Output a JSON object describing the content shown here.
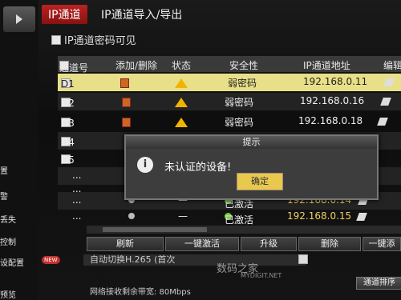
{
  "sidebar": {
    "items": [
      "置",
      "警",
      "丢失",
      "控制",
      "设配置"
    ],
    "preview_label": "预览",
    "new_badge": "NEW"
  },
  "tabs": [
    "IP通道",
    "IP通道导入/导出"
  ],
  "password_visible_label": "IP通道密码可见",
  "table": {
    "headers": [
      "通道号",
      "添加/删除",
      "状态",
      "安全性",
      "IP通道地址",
      "编辑"
    ],
    "rows": [
      {
        "channel": "D1",
        "security": "弱密码",
        "ip": "192.168.0.11"
      },
      {
        "channel": "D2",
        "security": "弱密码",
        "ip": "192.168.0.16"
      },
      {
        "channel": "D3",
        "security": "弱密码",
        "ip": "192.168.0.18"
      },
      {
        "channel": "D4",
        "security": "",
        "ip": ""
      },
      {
        "channel": "D5",
        "security": "",
        "ip": ""
      },
      {
        "channel": "...",
        "security": "",
        "ip": ""
      },
      {
        "channel": "...",
        "security": "",
        "ip": ""
      },
      {
        "channel": "...",
        "status": "—",
        "security": "已激活",
        "ip": "192.168.0.14"
      },
      {
        "channel": "...",
        "status": "—",
        "security": "已激活",
        "ip": "192.168.0.15"
      }
    ]
  },
  "dialog": {
    "title": "提示",
    "message": "未认证的设备!",
    "ok_label": "确定"
  },
  "buttons": {
    "refresh": "刷新",
    "activate": "一键激活",
    "upgrade": "升级",
    "delete": "删除",
    "one_click": "一键添"
  },
  "autoswitch_label": "自动切换H.265 (首次",
  "bandwidth_label": "网络接收剩余带宽: 80Mbps",
  "sort_label": "通道排序",
  "watermark": {
    "text": "数码之家",
    "url": "MYDIGIT.NET"
  },
  "colors": {
    "highlight_row": "#e8e088",
    "active_tab": "#b22222",
    "warning": "#f0b400",
    "ok_button": "#e8c94e"
  }
}
